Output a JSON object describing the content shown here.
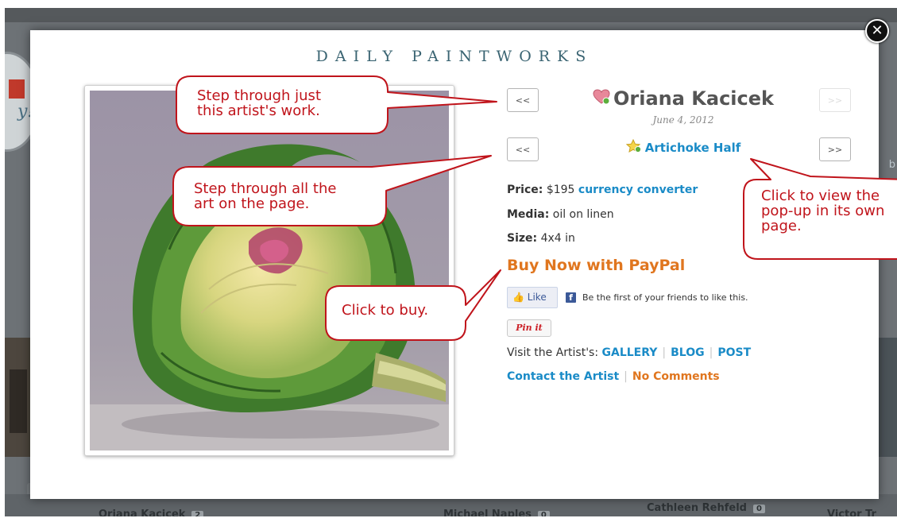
{
  "background": {
    "logo_text": "y!",
    "right_text": "b",
    "artists": [
      {
        "name": "Oriana Kacicek",
        "count": "2"
      },
      {
        "name": "Michael Naples",
        "count": "0"
      },
      {
        "name": "Cathleen Rehfeld",
        "count": "0"
      },
      {
        "name": "Victor Tr",
        "count": ""
      }
    ]
  },
  "modal": {
    "brand": "DAILY PAINTWORKS",
    "close_glyph": "✕",
    "artist_prev_label": "<<",
    "artist_next_label": ">>",
    "page_prev_label": "<<",
    "page_next_label": ">>",
    "artist_name": "Oriana Kacicek",
    "post_date": "June 4, 2012",
    "art_title": "Artichoke Half",
    "price_label": "Price:",
    "price_value": "$195",
    "currency_link": "currency converter",
    "media_label": "Media:",
    "media_value": "oil on linen",
    "size_label": "Size:",
    "size_value": "4x4 in",
    "buy_label": "Buy Now with PayPal",
    "like_label": "Like",
    "fb_glyph": "f",
    "fb_text": "Be the first of your friends to like this.",
    "pin_label": "Pin it",
    "visit_label": "Visit the Artist's:",
    "gallery_link": "GALLERY",
    "blog_link": "BLOG",
    "post_link": "POST",
    "contact_link": "Contact the Artist",
    "comments_link": "No Comments"
  },
  "callouts": {
    "artist_nav": [
      "Step through just",
      "this artist's work."
    ],
    "page_nav": [
      "Step through all the",
      "art on the page."
    ],
    "buy": [
      "Click to buy."
    ],
    "popup": [
      "Click to view the",
      "pop-up in its own",
      "page."
    ]
  },
  "colors": {
    "link": "#1a8bc7",
    "orange": "#e0761f",
    "callout_border": "#c0141b",
    "brand": "#3a6472"
  }
}
